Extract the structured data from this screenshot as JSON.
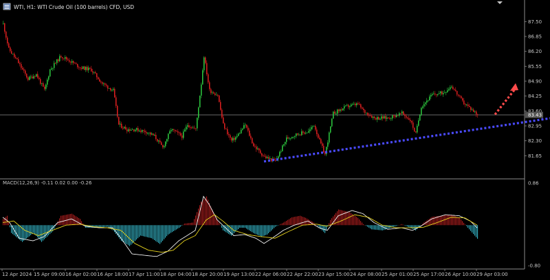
{
  "header": {
    "title": "WTI, H1:  WTI Crude Oil (100 barrels) CFD, USD"
  },
  "colors": {
    "background": "#000000",
    "bull": "#2ecc40",
    "bear": "#e02020",
    "grid_line": "#8c8c8c",
    "trendline": "#4a4aff",
    "projection": "#ff4a4a",
    "macd_hist_pos": "#b01e1e",
    "macd_hist_neg": "#35b6c8",
    "macd_line": "#f0f0f0",
    "signal_line": "#e6d21e",
    "axis_text": "#c8c8c8",
    "current_price_bg": "#555555"
  },
  "icons": [
    "chart-window-icon",
    "dropdown-triangle-icon"
  ],
  "chart_data": [
    {
      "type": "candlestick",
      "symbol": "WTI",
      "timeframe": "H1",
      "ylim": [
        81.0,
        87.9
      ],
      "y_ticks": [
        "87.50",
        "86.85",
        "86.20",
        "85.55",
        "84.90",
        "84.25",
        "83.60",
        "83.43",
        "82.95",
        "82.30",
        "81.65"
      ],
      "current_price": "83.43",
      "x_ticks": [
        "12 Apr 2024",
        "15 Apr 09:00",
        "16 Apr 02:00",
        "16 Apr 18:00",
        "17 Apr 11:00",
        "18 Apr 04:00",
        "18 Apr 20:00",
        "19 Apr 13:00",
        "22 Apr 06:00",
        "22 Apr 22:00",
        "23 Apr 15:00",
        "24 Apr 08:00",
        "25 Apr 01:00",
        "25 Apr 17:00",
        "26 Apr 10:00",
        "29 Apr 03:00"
      ],
      "anchors": [
        [
          0,
          87.4
        ],
        [
          4,
          86.3
        ],
        [
          10,
          85.8
        ],
        [
          18,
          85.0
        ],
        [
          24,
          85.2
        ],
        [
          30,
          84.5
        ],
        [
          34,
          85.4
        ],
        [
          42,
          86.0
        ],
        [
          48,
          85.8
        ],
        [
          56,
          85.5
        ],
        [
          64,
          85.4
        ],
        [
          72,
          84.8
        ],
        [
          80,
          84.5
        ],
        [
          84,
          83.0
        ],
        [
          90,
          82.8
        ],
        [
          96,
          82.8
        ],
        [
          104,
          82.7
        ],
        [
          110,
          82.5
        ],
        [
          116,
          82.0
        ],
        [
          122,
          82.8
        ],
        [
          130,
          82.5
        ],
        [
          134,
          83.0
        ],
        [
          140,
          82.8
        ],
        [
          144,
          84.8
        ],
        [
          146,
          86.0
        ],
        [
          150,
          84.5
        ],
        [
          156,
          84.3
        ],
        [
          160,
          83.0
        ],
        [
          166,
          82.3
        ],
        [
          170,
          82.5
        ],
        [
          176,
          83.0
        ],
        [
          182,
          82.1
        ],
        [
          190,
          81.6
        ],
        [
          194,
          81.5
        ],
        [
          198,
          81.4
        ],
        [
          206,
          82.4
        ],
        [
          214,
          82.6
        ],
        [
          222,
          82.7
        ],
        [
          226,
          83.0
        ],
        [
          230,
          82.3
        ],
        [
          234,
          81.7
        ],
        [
          240,
          83.5
        ],
        [
          250,
          83.8
        ],
        [
          258,
          83.9
        ],
        [
          262,
          83.6
        ],
        [
          270,
          83.3
        ],
        [
          280,
          83.3
        ],
        [
          290,
          83.5
        ],
        [
          296,
          83.2
        ],
        [
          300,
          82.6
        ],
        [
          304,
          83.8
        ],
        [
          312,
          84.3
        ],
        [
          320,
          84.4
        ],
        [
          326,
          84.7
        ],
        [
          334,
          84.0
        ],
        [
          340,
          83.7
        ],
        [
          345,
          83.45
        ]
      ],
      "annotations": [
        {
          "type": "dotted-trendline",
          "from": [
            190,
            81.4
          ],
          "to": [
            400,
            83.3
          ]
        },
        {
          "type": "dotted-arrow",
          "from": [
            358,
            83.45
          ],
          "to": [
            372,
            84.75
          ]
        }
      ]
    },
    {
      "type": "macd-histogram",
      "label": "MACD(12,26,9) -0.11 0.02 0.00 -0.26",
      "ylim": [
        -0.8,
        0.86
      ],
      "y_ticks": [
        "0.86",
        "-0.80"
      ],
      "anchors_hist": [
        [
          0,
          0.12
        ],
        [
          3,
          0.18
        ],
        [
          6,
          -0.15
        ],
        [
          14,
          -0.32
        ],
        [
          22,
          -0.15
        ],
        [
          28,
          -0.32
        ],
        [
          36,
          -0.12
        ],
        [
          42,
          0.18
        ],
        [
          50,
          0.22
        ],
        [
          56,
          0.12
        ],
        [
          60,
          -0.05
        ],
        [
          68,
          -0.05
        ],
        [
          76,
          -0.03
        ],
        [
          80,
          -0.1
        ],
        [
          86,
          -0.3
        ],
        [
          92,
          -0.4
        ],
        [
          100,
          -0.2
        ],
        [
          108,
          -0.25
        ],
        [
          114,
          -0.36
        ],
        [
          120,
          -0.18
        ],
        [
          128,
          -0.05
        ],
        [
          132,
          0.03
        ],
        [
          138,
          0.05
        ],
        [
          144,
          0.45
        ],
        [
          148,
          0.55
        ],
        [
          152,
          0.3
        ],
        [
          156,
          0.1
        ],
        [
          160,
          -0.1
        ],
        [
          166,
          -0.2
        ],
        [
          172,
          -0.05
        ],
        [
          176,
          -0.05
        ],
        [
          182,
          -0.15
        ],
        [
          188,
          -0.22
        ],
        [
          192,
          -0.18
        ],
        [
          198,
          -0.03
        ],
        [
          204,
          0.05
        ],
        [
          210,
          0.15
        ],
        [
          216,
          0.18
        ],
        [
          220,
          0.14
        ],
        [
          226,
          0.05
        ],
        [
          230,
          -0.05
        ],
        [
          234,
          -0.15
        ],
        [
          238,
          0.1
        ],
        [
          244,
          0.3
        ],
        [
          252,
          0.25
        ],
        [
          258,
          0.14
        ],
        [
          262,
          0.02
        ],
        [
          268,
          -0.08
        ],
        [
          276,
          -0.1
        ],
        [
          282,
          -0.05
        ],
        [
          290,
          0.02
        ],
        [
          296,
          -0.05
        ],
        [
          300,
          -0.1
        ],
        [
          306,
          0.05
        ],
        [
          312,
          0.16
        ],
        [
          318,
          0.18
        ],
        [
          326,
          0.2
        ],
        [
          332,
          0.14
        ],
        [
          338,
          -0.05
        ],
        [
          345,
          -0.26
        ]
      ],
      "anchors_macd": [
        [
          0,
          0.15
        ],
        [
          5,
          0.05
        ],
        [
          12,
          -0.25
        ],
        [
          22,
          -0.3
        ],
        [
          30,
          -0.22
        ],
        [
          40,
          0.05
        ],
        [
          50,
          0.12
        ],
        [
          60,
          -0.02
        ],
        [
          70,
          -0.05
        ],
        [
          80,
          -0.05
        ],
        [
          86,
          -0.25
        ],
        [
          94,
          -0.55
        ],
        [
          104,
          -0.58
        ],
        [
          112,
          -0.6
        ],
        [
          120,
          -0.5
        ],
        [
          128,
          -0.3
        ],
        [
          134,
          -0.2
        ],
        [
          140,
          -0.1
        ],
        [
          146,
          0.55
        ],
        [
          150,
          0.4
        ],
        [
          156,
          0.1
        ],
        [
          162,
          -0.05
        ],
        [
          168,
          -0.2
        ],
        [
          176,
          -0.18
        ],
        [
          184,
          -0.25
        ],
        [
          190,
          -0.35
        ],
        [
          196,
          -0.25
        ],
        [
          204,
          -0.1
        ],
        [
          212,
          0.0
        ],
        [
          222,
          0.08
        ],
        [
          230,
          -0.05
        ],
        [
          236,
          -0.1
        ],
        [
          244,
          0.18
        ],
        [
          254,
          0.28
        ],
        [
          262,
          0.22
        ],
        [
          270,
          0.05
        ],
        [
          280,
          -0.08
        ],
        [
          290,
          -0.05
        ],
        [
          298,
          -0.1
        ],
        [
          304,
          -0.02
        ],
        [
          312,
          0.12
        ],
        [
          322,
          0.2
        ],
        [
          332,
          0.18
        ],
        [
          340,
          0.08
        ],
        [
          345,
          -0.05
        ]
      ],
      "anchors_signal": [
        [
          0,
          0.05
        ],
        [
          8,
          0.08
        ],
        [
          16,
          -0.1
        ],
        [
          26,
          -0.2
        ],
        [
          36,
          -0.1
        ],
        [
          46,
          0.0
        ],
        [
          56,
          0.02
        ],
        [
          66,
          -0.03
        ],
        [
          76,
          -0.05
        ],
        [
          86,
          -0.1
        ],
        [
          96,
          -0.35
        ],
        [
          106,
          -0.48
        ],
        [
          116,
          -0.52
        ],
        [
          124,
          -0.48
        ],
        [
          132,
          -0.3
        ],
        [
          140,
          -0.2
        ],
        [
          148,
          0.1
        ],
        [
          154,
          0.2
        ],
        [
          160,
          0.08
        ],
        [
          168,
          -0.1
        ],
        [
          178,
          -0.18
        ],
        [
          188,
          -0.22
        ],
        [
          198,
          -0.25
        ],
        [
          208,
          -0.12
        ],
        [
          218,
          0.0
        ],
        [
          228,
          0.02
        ],
        [
          236,
          -0.02
        ],
        [
          246,
          0.08
        ],
        [
          256,
          0.2
        ],
        [
          266,
          0.15
        ],
        [
          276,
          0.0
        ],
        [
          286,
          -0.05
        ],
        [
          296,
          -0.05
        ],
        [
          306,
          -0.04
        ],
        [
          316,
          0.05
        ],
        [
          326,
          0.15
        ],
        [
          336,
          0.14
        ],
        [
          345,
          0.0
        ]
      ]
    }
  ]
}
